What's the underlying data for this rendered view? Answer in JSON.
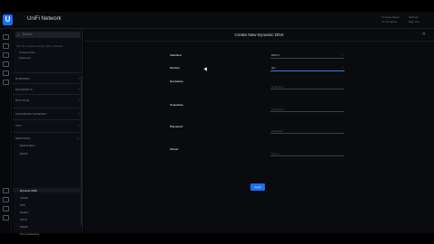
{
  "header": {
    "logo_glyph": "U",
    "brand": "UniFi Network",
    "account_lines": [
      "Console Name",
      "v1.0.0 admin"
    ],
    "account_right_lines": [
      "Settings",
      "Sign Out"
    ]
  },
  "sidebar": {
    "search_placeholder": "Search",
    "search_icon": "search-icon",
    "hint": "Use ⌘ to search settings, WiFi, networks.",
    "top_links": [
      "Unsaved Site",
      "Password"
    ],
    "sections": [
      {
        "label": "INTERNET"
      },
      {
        "label": "NETWORKS"
      },
      {
        "label": "ROUTING"
      },
      {
        "label": "ADVANCED GATEWAY"
      },
      {
        "label": "VPN"
      },
      {
        "label": "SERVICES",
        "expanded": true
      }
    ],
    "services_items": [
      {
        "label": "Multi Subnet"
      },
      {
        "label": "DHCP"
      },
      {
        "label": "Dynamic DNS",
        "active": true
      },
      {
        "label": "mDNS"
      },
      {
        "label": "NTP"
      },
      {
        "label": "Radius"
      },
      {
        "label": "UPnP"
      },
      {
        "label": "SNMP"
      },
      {
        "label": "Port Forwarding"
      }
    ]
  },
  "panel": {
    "title": "Create New Dynamic DNS",
    "close_icon": "close-icon",
    "fields": [
      {
        "label": "Interface",
        "value": "WAN 1",
        "placeholder": "",
        "type": "select"
      },
      {
        "label": "Service",
        "value": "dyn",
        "placeholder": "",
        "type": "select",
        "active": true
      },
      {
        "label": "Hostname",
        "value": "",
        "placeholder": "Hostname",
        "type": "text"
      },
      {
        "label": "Username",
        "value": "",
        "placeholder": "Username",
        "type": "text"
      },
      {
        "label": "Password",
        "value": "",
        "placeholder": "Password",
        "type": "text"
      },
      {
        "label": "Server",
        "value": "",
        "placeholder": "Server",
        "type": "text"
      }
    ],
    "apply_label": "Apply"
  },
  "colors": {
    "accent": "#1d6ef2",
    "background": "#0a0b0f",
    "sidebar": "#0c0d12"
  }
}
